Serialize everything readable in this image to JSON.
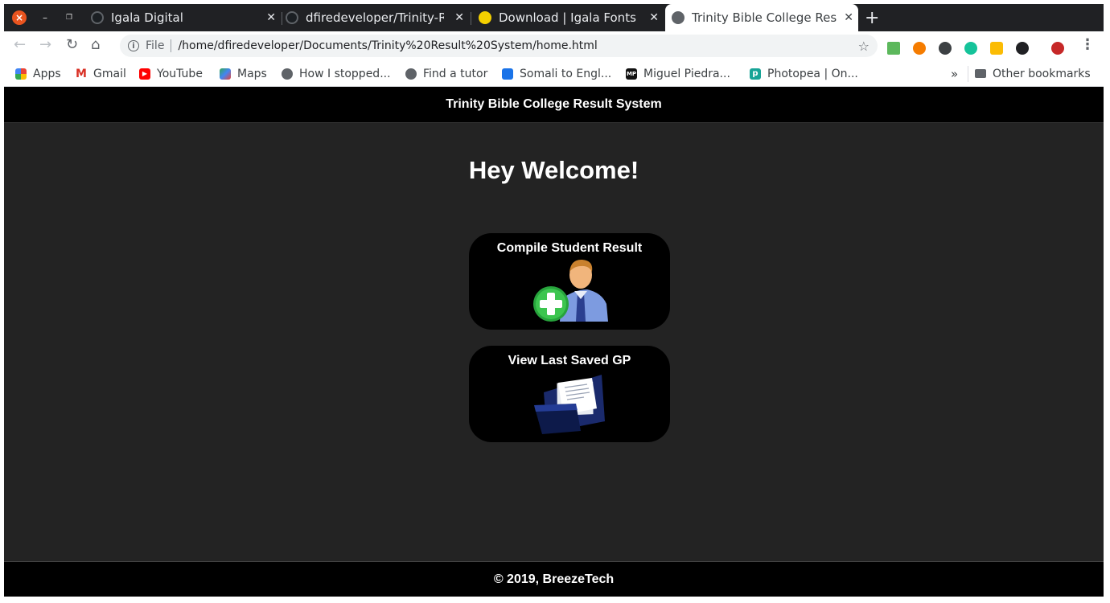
{
  "browser": {
    "tabs": [
      {
        "title": "Igala Digital",
        "favicon": "github-icon",
        "active": false
      },
      {
        "title": "dfiredeveloper/Trinity-Re",
        "favicon": "github-icon",
        "active": false
      },
      {
        "title": "Download | Igala Fonts",
        "favicon": "igala-fonts-icon",
        "active": false
      },
      {
        "title": "Trinity Bible College Resul",
        "favicon": "globe-icon",
        "active": true
      }
    ],
    "address": {
      "scheme_label": "File",
      "url": "/home/dfiredeveloper/Documents/Trinity%20Result%20System/home.html"
    },
    "bookmarks": [
      {
        "label": "Apps",
        "icon": "apps-grid-icon"
      },
      {
        "label": "Gmail",
        "icon": "gmail-icon"
      },
      {
        "label": "YouTube",
        "icon": "youtube-icon"
      },
      {
        "label": "Maps",
        "icon": "maps-icon"
      },
      {
        "label": "How I stopped...",
        "icon": "globe-icon"
      },
      {
        "label": "Find a tutor",
        "icon": "globe-icon"
      },
      {
        "label": "Somali to Engl...",
        "icon": "translator-icon"
      },
      {
        "label": "Miguel Piedra...",
        "icon": "mp-icon"
      },
      {
        "label": "Photopea | On...",
        "icon": "photopea-icon"
      }
    ],
    "bookmarks_overflow": "»",
    "other_bookmarks": "Other bookmarks"
  },
  "page": {
    "header_title": "Trinity Bible College Result System",
    "welcome": "Hey Welcome!",
    "cards": [
      {
        "label": "Compile Student Result",
        "icon": "add-user-icon"
      },
      {
        "label": "View Last Saved GP",
        "icon": "folder-document-icon"
      }
    ],
    "footer": "© 2019, BreezeTech"
  }
}
